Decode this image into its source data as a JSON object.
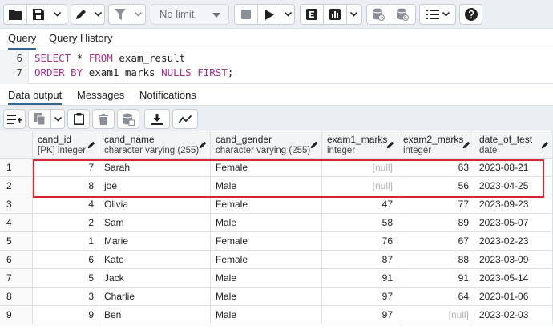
{
  "toolbar": {
    "limit_select": "No limit"
  },
  "query_tabs": [
    "Query",
    "Query History"
  ],
  "editor": {
    "lines": [
      {
        "num": "6",
        "tokens": [
          {
            "t": "SELECT",
            "kw": true
          },
          {
            "t": " * "
          },
          {
            "t": "FROM",
            "kw": true
          },
          {
            "t": " exam_result"
          }
        ]
      },
      {
        "num": "7",
        "tokens": [
          {
            "t": "ORDER BY",
            "kw": true
          },
          {
            "t": " exam1_marks "
          },
          {
            "t": "NULLS FIRST",
            "kw": true
          },
          {
            "t": ";"
          }
        ]
      }
    ]
  },
  "result_tabs": [
    "Data output",
    "Messages",
    "Notifications"
  ],
  "columns": [
    {
      "name": "cand_id",
      "type": "[PK] integer"
    },
    {
      "name": "cand_name",
      "type": "character varying (255)"
    },
    {
      "name": "cand_gender",
      "type": "character varying (255)"
    },
    {
      "name": "exam1_marks",
      "type": "integer"
    },
    {
      "name": "exam2_marks",
      "type": "integer"
    },
    {
      "name": "date_of_test",
      "type": "date"
    }
  ],
  "rows": [
    {
      "n": "1",
      "cand_id": "7",
      "cand_name": "Sarah",
      "cand_gender": "Female",
      "exam1_marks": "[null]",
      "exam2_marks": "63",
      "date_of_test": "2023-08-21"
    },
    {
      "n": "2",
      "cand_id": "8",
      "cand_name": "joe",
      "cand_gender": "Male",
      "exam1_marks": "[null]",
      "exam2_marks": "56",
      "date_of_test": "2023-04-25"
    },
    {
      "n": "3",
      "cand_id": "4",
      "cand_name": "Olivia",
      "cand_gender": "Female",
      "exam1_marks": "47",
      "exam2_marks": "77",
      "date_of_test": "2023-09-23"
    },
    {
      "n": "4",
      "cand_id": "2",
      "cand_name": "Sam",
      "cand_gender": "Male",
      "exam1_marks": "58",
      "exam2_marks": "89",
      "date_of_test": "2023-05-07"
    },
    {
      "n": "5",
      "cand_id": "1",
      "cand_name": "Marie",
      "cand_gender": "Female",
      "exam1_marks": "76",
      "exam2_marks": "67",
      "date_of_test": "2023-02-23"
    },
    {
      "n": "6",
      "cand_id": "6",
      "cand_name": "Kate",
      "cand_gender": "Female",
      "exam1_marks": "87",
      "exam2_marks": "88",
      "date_of_test": "2023-03-09"
    },
    {
      "n": "7",
      "cand_id": "5",
      "cand_name": "Jack",
      "cand_gender": "Male",
      "exam1_marks": "91",
      "exam2_marks": "91",
      "date_of_test": "2023-05-14"
    },
    {
      "n": "8",
      "cand_id": "3",
      "cand_name": "Charlie",
      "cand_gender": "Male",
      "exam1_marks": "97",
      "exam2_marks": "64",
      "date_of_test": "2023-01-06"
    },
    {
      "n": "9",
      "cand_id": "9",
      "cand_name": "Ben",
      "cand_gender": "Male",
      "exam1_marks": "97",
      "exam2_marks": "[null]",
      "date_of_test": "2023-02-03"
    }
  ],
  "colors": {
    "highlight": "#d4262c",
    "keyword": "#a03090",
    "active_tab": "#326690"
  }
}
